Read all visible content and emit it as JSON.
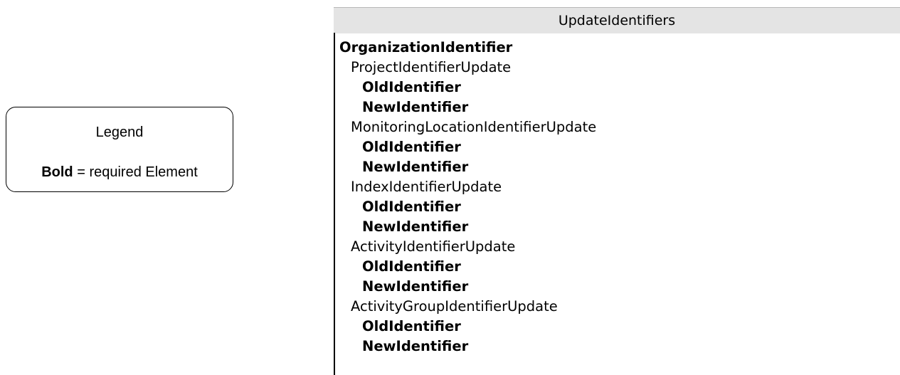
{
  "legend": {
    "title": "Legend",
    "bold_word": "Bold",
    "description": " = required Element"
  },
  "panel": {
    "title": "UpdateIdentifiers"
  },
  "tree": [
    {
      "label": "OrganizationIdentifier",
      "level": 0,
      "required": true
    },
    {
      "label": "ProjectIdentifierUpdate",
      "level": 1,
      "required": false
    },
    {
      "label": "OldIdentifier",
      "level": 2,
      "required": true
    },
    {
      "label": "NewIdentifier",
      "level": 2,
      "required": true
    },
    {
      "label": "MonitoringLocationIdentifierUpdate",
      "level": 1,
      "required": false
    },
    {
      "label": "OldIdentifier",
      "level": 2,
      "required": true
    },
    {
      "label": "NewIdentifier",
      "level": 2,
      "required": true
    },
    {
      "label": "IndexIdentifierUpdate",
      "level": 1,
      "required": false
    },
    {
      "label": "OldIdentifier",
      "level": 2,
      "required": true
    },
    {
      "label": "NewIdentifier",
      "level": 2,
      "required": true
    },
    {
      "label": "ActivityIdentifierUpdate",
      "level": 1,
      "required": false
    },
    {
      "label": "OldIdentifier",
      "level": 2,
      "required": true
    },
    {
      "label": "NewIdentifier",
      "level": 2,
      "required": true
    },
    {
      "label": "ActivityGroupIdentifierUpdate",
      "level": 1,
      "required": false
    },
    {
      "label": "OldIdentifier",
      "level": 2,
      "required": true
    },
    {
      "label": "NewIdentifier",
      "level": 2,
      "required": true
    }
  ]
}
